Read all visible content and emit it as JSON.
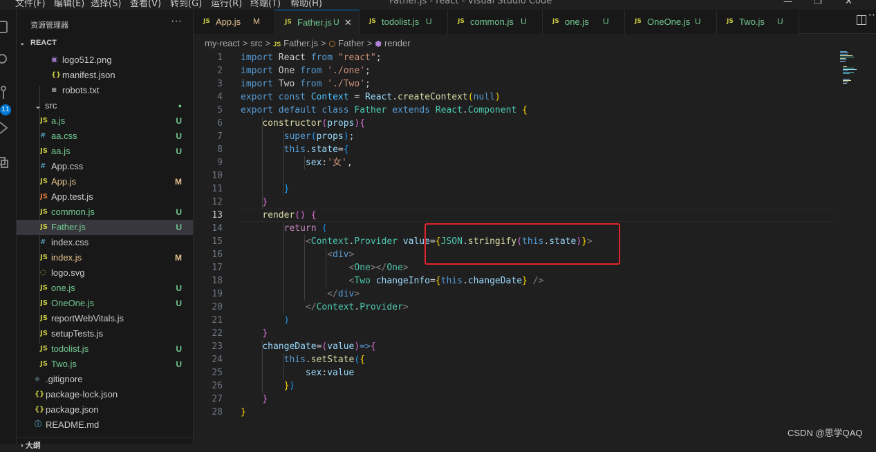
{
  "window": {
    "title": "Father.js - react - Visual Studio Code",
    "menus": [
      "文件(F)",
      "编辑(E)",
      "选择(S)",
      "查看(V)",
      "转到(G)",
      "运行(R)",
      "终端(T)",
      "帮助(H)"
    ]
  },
  "activity_bar": {
    "badge": "11",
    "icons": [
      "explorer-icon",
      "search-icon",
      "source-control-icon",
      "run-debug-icon",
      "extensions-icon"
    ]
  },
  "sidebar": {
    "title": "资源管理器",
    "more": "···",
    "section": "REACT",
    "outline": "大纲",
    "files": [
      {
        "name": "logo512.png",
        "icon": "img",
        "status": "",
        "status_color": ""
      },
      {
        "name": "manifest.json",
        "icon": "json",
        "status": "",
        "status_color": ""
      },
      {
        "name": "robots.txt",
        "icon": "txt",
        "status": "",
        "status_color": ""
      },
      {
        "name": "src",
        "icon": "folder",
        "status": "●",
        "status_color": "#73c991"
      },
      {
        "name": "a.js",
        "icon": "js",
        "status": "U",
        "status_color": "#73c991"
      },
      {
        "name": "aa.css",
        "icon": "css",
        "status": "U",
        "status_color": "#73c991"
      },
      {
        "name": "aa.js",
        "icon": "js",
        "status": "U",
        "status_color": "#73c991"
      },
      {
        "name": "App.css",
        "icon": "css",
        "status": "",
        "status_color": ""
      },
      {
        "name": "App.js",
        "icon": "js",
        "status": "M",
        "status_color": "#e2c08d"
      },
      {
        "name": "App.test.js",
        "icon": "jstest",
        "status": "",
        "status_color": ""
      },
      {
        "name": "common.js",
        "icon": "js",
        "status": "U",
        "status_color": "#73c991"
      },
      {
        "name": "Father.js",
        "icon": "js",
        "status": "U",
        "status_color": "#73c991"
      },
      {
        "name": "index.css",
        "icon": "css",
        "status": "",
        "status_color": ""
      },
      {
        "name": "index.js",
        "icon": "js",
        "status": "M",
        "status_color": "#e2c08d"
      },
      {
        "name": "logo.svg",
        "icon": "svg",
        "status": "",
        "status_color": ""
      },
      {
        "name": "one.js",
        "icon": "js",
        "status": "U",
        "status_color": "#73c991"
      },
      {
        "name": "OneOne.js",
        "icon": "js",
        "status": "U",
        "status_color": "#73c991"
      },
      {
        "name": "reportWebVitals.js",
        "icon": "js",
        "status": "",
        "status_color": ""
      },
      {
        "name": "setupTests.js",
        "icon": "js",
        "status": "",
        "status_color": ""
      },
      {
        "name": "todolist.js",
        "icon": "js",
        "status": "U",
        "status_color": "#73c991"
      },
      {
        "name": "Two.js",
        "icon": "js",
        "status": "U",
        "status_color": "#73c991"
      },
      {
        "name": ".gitignore",
        "icon": "git",
        "status": "",
        "status_color": ""
      },
      {
        "name": "package-lock.json",
        "icon": "json",
        "status": "",
        "status_color": ""
      },
      {
        "name": "package.json",
        "icon": "json",
        "status": "",
        "status_color": ""
      },
      {
        "name": "README.md",
        "icon": "info",
        "status": "",
        "status_color": ""
      }
    ]
  },
  "tabs": [
    {
      "label": "App.js",
      "status": "M",
      "status_color": "#e2c08d",
      "label_color": "#e2c08d"
    },
    {
      "label": "Father.js",
      "status": "U",
      "status_color": "#73c991",
      "label_color": "#73c991",
      "close": "✕"
    },
    {
      "label": "todolist.js",
      "status": "U",
      "status_color": "#73c991",
      "label_color": "#73c991"
    },
    {
      "label": "common.js",
      "status": "U",
      "status_color": "#73c991",
      "label_color": "#73c991"
    },
    {
      "label": "one.js",
      "status": "U",
      "status_color": "#73c991",
      "label_color": "#73c991"
    },
    {
      "label": "OneOne.js",
      "status": "U",
      "status_color": "#73c991",
      "label_color": "#73c991"
    },
    {
      "label": "Two.js",
      "status": "U",
      "status_color": "#73c991",
      "label_color": "#73c991"
    }
  ],
  "breadcrumb": {
    "items": [
      "my-react",
      "src",
      "Father.js",
      "Father",
      "render"
    ],
    "separator": ">"
  },
  "editor": {
    "current_line": 13,
    "lines": [
      [
        [
          "k",
          "import"
        ],
        [
          "p",
          " React "
        ],
        [
          "k",
          "from"
        ],
        [
          "s",
          " \"react\""
        ],
        [
          "p",
          ";"
        ]
      ],
      [
        [
          "k",
          "import"
        ],
        [
          "p",
          " One "
        ],
        [
          "k",
          "from"
        ],
        [
          "s",
          " './one'"
        ],
        [
          "p",
          ";"
        ]
      ],
      [
        [
          "k",
          "import"
        ],
        [
          "p",
          " Two "
        ],
        [
          "k",
          "from"
        ],
        [
          "s",
          " './Two'"
        ],
        [
          "p",
          ";"
        ]
      ],
      [
        [
          "k",
          "export"
        ],
        [
          "t",
          " const "
        ],
        [
          "cc",
          "Context"
        ],
        [
          "p",
          " = "
        ],
        [
          "v",
          "React"
        ],
        [
          "p",
          "."
        ],
        [
          "f",
          "createContext"
        ],
        [
          "b1",
          "("
        ],
        [
          "t",
          "null"
        ],
        [
          "b1",
          ")"
        ]
      ],
      [
        [
          "k",
          "export"
        ],
        [
          "k",
          " default "
        ],
        [
          "t",
          "class "
        ],
        [
          "c",
          "Father"
        ],
        [
          "t",
          " extends "
        ],
        [
          "c",
          "React"
        ],
        [
          "p",
          "."
        ],
        [
          "c",
          "Component"
        ],
        [
          "p",
          " "
        ],
        [
          "b1",
          "{"
        ]
      ],
      [
        [
          "p",
          "    "
        ],
        [
          "f",
          "constructor"
        ],
        [
          "b2",
          "("
        ],
        [
          "v",
          "props"
        ],
        [
          "b2",
          ")"
        ],
        [
          "b2",
          "{"
        ]
      ],
      [
        [
          "p",
          "        "
        ],
        [
          "t",
          "super"
        ],
        [
          "b3",
          "("
        ],
        [
          "v",
          "props"
        ],
        [
          "b3",
          ")"
        ],
        [
          "p",
          ";"
        ]
      ],
      [
        [
          "p",
          "        "
        ],
        [
          "t",
          "this"
        ],
        [
          "p",
          "."
        ],
        [
          "v",
          "state"
        ],
        [
          "p",
          "="
        ],
        [
          "b3",
          "{"
        ]
      ],
      [
        [
          "p",
          "            "
        ],
        [
          "v",
          "sex"
        ],
        [
          "p",
          ":"
        ],
        [
          "s",
          "'女'"
        ],
        [
          "p",
          ","
        ]
      ],
      [
        [
          "p",
          ""
        ]
      ],
      [
        [
          "p",
          "        "
        ],
        [
          "b3",
          "}"
        ]
      ],
      [
        [
          "p",
          "    "
        ],
        [
          "b2",
          "}"
        ]
      ],
      [
        [
          "p",
          "    "
        ],
        [
          "f",
          "render"
        ],
        [
          "b2",
          "()"
        ],
        [
          "p",
          " "
        ],
        [
          "b2",
          "{"
        ]
      ],
      [
        [
          "p",
          "        "
        ],
        [
          "kc",
          "return"
        ],
        [
          "p",
          " "
        ],
        [
          "b3",
          "("
        ]
      ],
      [
        [
          "p",
          "            "
        ],
        [
          "g",
          "<"
        ],
        [
          "c",
          "Context"
        ],
        [
          "p",
          "."
        ],
        [
          "c",
          "Provider"
        ],
        [
          "p",
          " "
        ],
        [
          "v",
          "value"
        ],
        [
          "p",
          "="
        ],
        [
          "b1",
          "{"
        ],
        [
          "c",
          "JSON"
        ],
        [
          "p",
          "."
        ],
        [
          "f",
          "stringify"
        ],
        [
          "b2",
          "("
        ],
        [
          "t",
          "this"
        ],
        [
          "p",
          "."
        ],
        [
          "v",
          "state"
        ],
        [
          "b2",
          ")"
        ],
        [
          "b1",
          "}"
        ],
        [
          "g",
          ">"
        ]
      ],
      [
        [
          "p",
          "                "
        ],
        [
          "g",
          "<"
        ],
        [
          "t",
          "div"
        ],
        [
          "g",
          ">"
        ]
      ],
      [
        [
          "p",
          "                    "
        ],
        [
          "g",
          "<"
        ],
        [
          "c",
          "One"
        ],
        [
          "g",
          "></"
        ],
        [
          "c",
          "One"
        ],
        [
          "g",
          ">"
        ]
      ],
      [
        [
          "p",
          "                    "
        ],
        [
          "g",
          "<"
        ],
        [
          "c",
          "Two"
        ],
        [
          "p",
          " "
        ],
        [
          "v",
          "changeInfo"
        ],
        [
          "p",
          "="
        ],
        [
          "b1",
          "{"
        ],
        [
          "t",
          "this"
        ],
        [
          "p",
          "."
        ],
        [
          "v",
          "changeDate"
        ],
        [
          "b1",
          "}"
        ],
        [
          "p",
          " "
        ],
        [
          "g",
          "/>"
        ]
      ],
      [
        [
          "p",
          "                "
        ],
        [
          "g",
          "</"
        ],
        [
          "t",
          "div"
        ],
        [
          "g",
          ">"
        ]
      ],
      [
        [
          "p",
          "            "
        ],
        [
          "g",
          "</"
        ],
        [
          "c",
          "Context"
        ],
        [
          "p",
          "."
        ],
        [
          "c",
          "Provider"
        ],
        [
          "g",
          ">"
        ]
      ],
      [
        [
          "p",
          "        "
        ],
        [
          "b3",
          ")"
        ]
      ],
      [
        [
          "p",
          "    "
        ],
        [
          "b2",
          "}"
        ]
      ],
      [
        [
          "p",
          "    "
        ],
        [
          "v",
          "changeDate"
        ],
        [
          "p",
          "="
        ],
        [
          "b2",
          "("
        ],
        [
          "v",
          "value"
        ],
        [
          "b2",
          ")"
        ],
        [
          "t",
          "=>"
        ],
        [
          "b2",
          "{"
        ]
      ],
      [
        [
          "p",
          "        "
        ],
        [
          "t",
          "this"
        ],
        [
          "p",
          "."
        ],
        [
          "f",
          "setState"
        ],
        [
          "b3",
          "("
        ],
        [
          "b1",
          "{"
        ]
      ],
      [
        [
          "p",
          "            "
        ],
        [
          "v",
          "sex"
        ],
        [
          "p",
          ":"
        ],
        [
          "v",
          "value"
        ]
      ],
      [
        [
          "p",
          "        "
        ],
        [
          "b1",
          "}"
        ],
        [
          "b3",
          ")"
        ]
      ],
      [
        [
          "p",
          "    "
        ],
        [
          "b2",
          "}"
        ]
      ],
      [
        [
          "b1",
          "}"
        ]
      ]
    ]
  },
  "watermark": "CSDN @思学QAQ"
}
